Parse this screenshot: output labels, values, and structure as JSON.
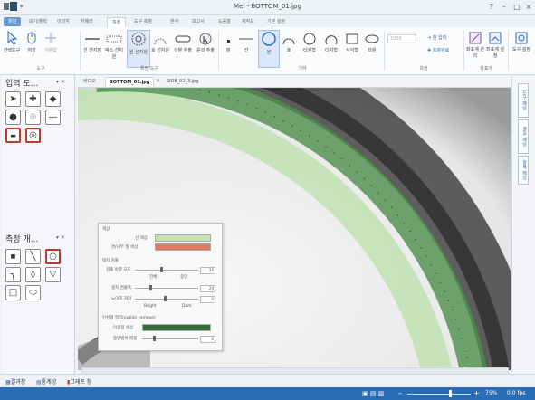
{
  "window": {
    "title": "Mel - BOTTOM_01.jpg",
    "controls": [
      "?",
      "–",
      "□",
      "×"
    ]
  },
  "ribbon_tabs": [
    {
      "label": "파일",
      "state": "active"
    },
    {
      "label": "보기/출력",
      "state": ""
    },
    {
      "label": "이미지",
      "state": ""
    },
    {
      "label": "카메라",
      "state": ""
    },
    {
      "label": "측정",
      "state": "selected"
    },
    {
      "label": "도구 측정",
      "state": ""
    },
    {
      "label": "분석",
      "state": ""
    },
    {
      "label": "보고서",
      "state": ""
    },
    {
      "label": "도움말",
      "state": ""
    },
    {
      "label": "제작도",
      "state": ""
    },
    {
      "label": "기본 설정",
      "state": ""
    }
  ],
  "ribbon": {
    "groups": [
      {
        "label": "도구",
        "buttons": [
          "선택도구",
          "저장",
          "기본값"
        ]
      },
      {
        "label": "확장 도구",
        "buttons": [
          "선 연지점",
          "박스 선지원",
          "원 선지원",
          "호 선지원",
          "선분 추출",
          "윤곽 추출"
        ]
      },
      {
        "label": "기하",
        "buttons": [
          "점",
          "선",
          "원",
          "호",
          "타원형",
          "다각형",
          "사각형",
          "타원"
        ]
      },
      {
        "label": "측정",
        "buttons": [
          "점 입력",
          "측정완료"
        ]
      },
      {
        "label": "좌표계",
        "buttons": [
          "좌표계 관리",
          "좌표계 설정"
        ]
      },
      {
        "label": "도구 설정",
        "buttons": [
          "도구 설정"
        ]
      }
    ],
    "mini_input": "1000"
  },
  "left_panel": {
    "input_title": "입력 도...",
    "measure_title": "측정 개...",
    "input_tools": [
      "pointer-icon",
      "crosshair-icon",
      "horizontal-icon",
      "mouse-icon",
      "ring-cross-icon",
      "line-icon",
      "bar-icon",
      "circle-target-icon"
    ],
    "measure_tools": [
      "point-icon",
      "slash-icon",
      "circle-icon",
      "curve-icon",
      "shield-icon",
      "flag-icon",
      "square-icon",
      "oval-icon"
    ]
  },
  "doc_tabs": [
    "BOTTOM_01.jpg",
    "SIDE_02_3.jpg"
  ],
  "doc_prefix": "비디오",
  "dialog": {
    "section_color": "색상",
    "line_color_label": "선 색상",
    "fill_color_label": "면/내부 칠 색상",
    "line_color": "#c8e4b4",
    "fill_color": "#e07a5f",
    "edge_section": "엣지 검출",
    "scan_label": "검출 방향 모드",
    "scan_left": "전체",
    "scan_right": "중앙",
    "width_label": "엣지 검출폭",
    "width_value": "20",
    "smooth_label": "노이즈 처리",
    "smooth_value": "0",
    "bright": "Bright",
    "dark": "Dark",
    "filter_section": "인성형 필터(outlier remove)",
    "filter_color_label": "이상점 색상",
    "filter_color": "#3a6b3a",
    "filter_range_label": "중앙범위 배율",
    "filter_range_value": "0"
  },
  "right_strip": [
    "도구 패널",
    "결과 패널",
    "항목 패널"
  ],
  "bottom_tabs": [
    {
      "label": "결과창",
      "icon": "result-icon"
    },
    {
      "label": "통계창",
      "icon": "stats-icon"
    },
    {
      "label": "그래프 창",
      "icon": "graph-icon"
    }
  ],
  "status": {
    "zoom": "75%",
    "fps": "0.0 fps"
  }
}
